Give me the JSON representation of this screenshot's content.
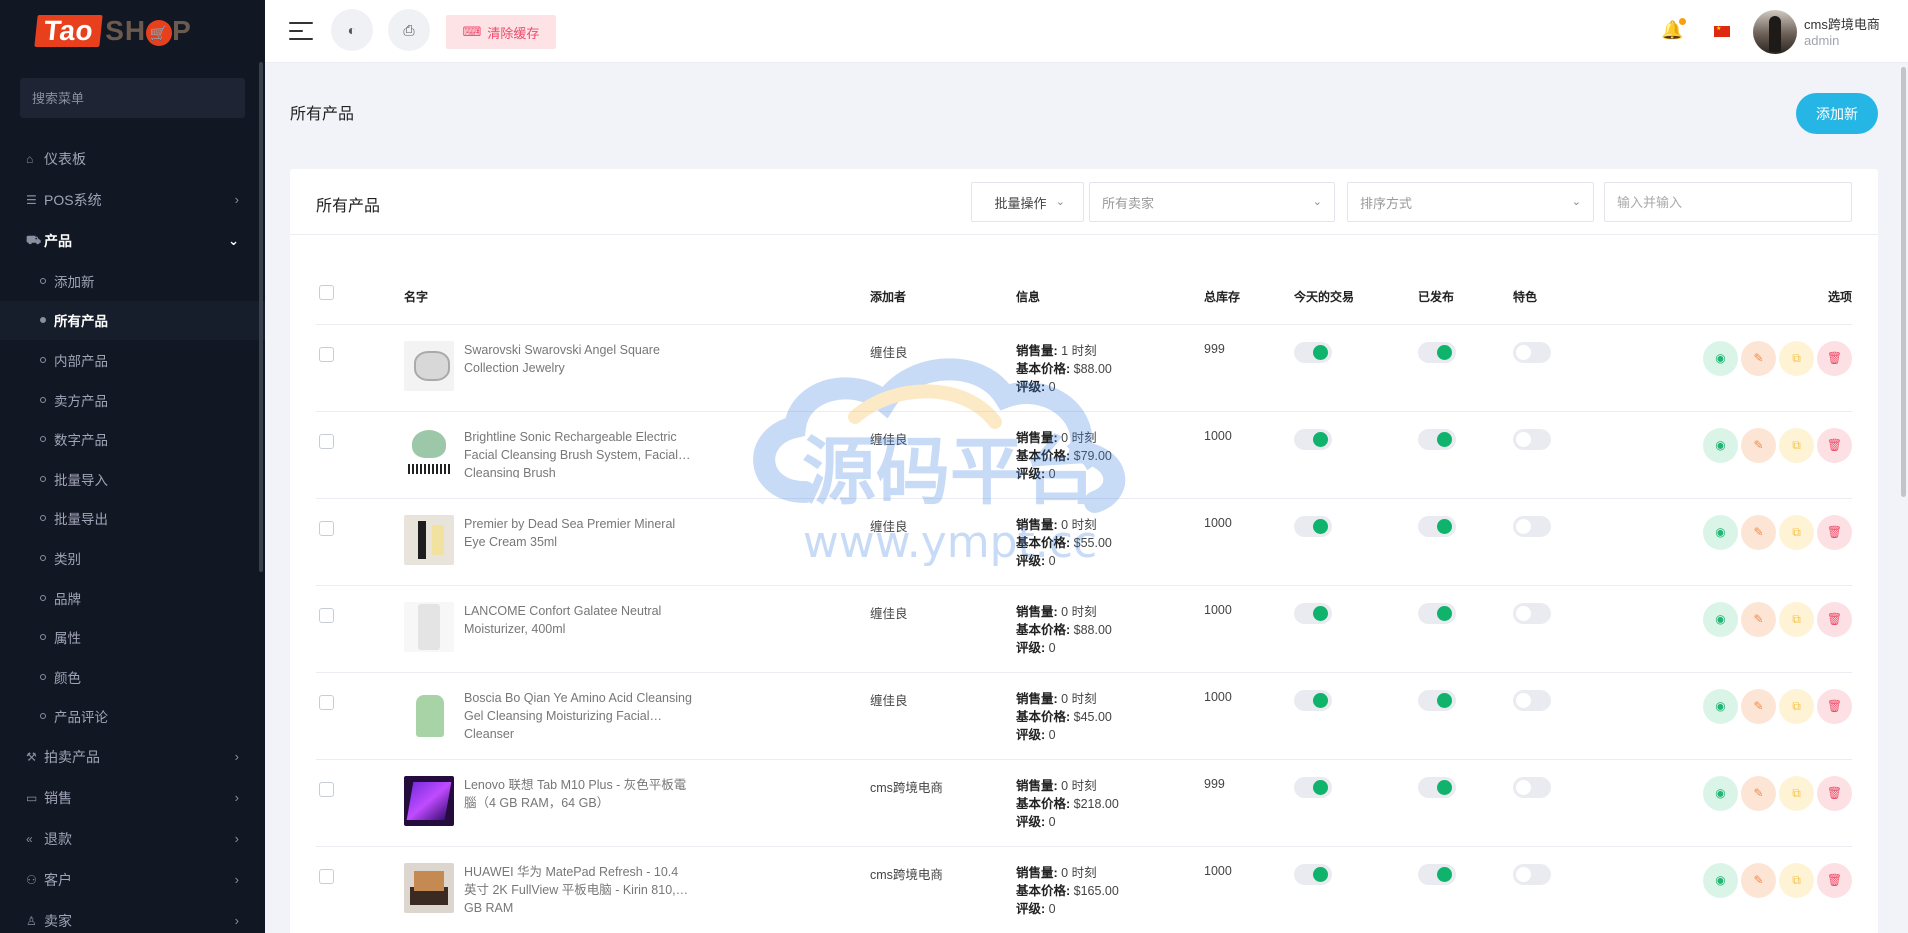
{
  "logo": {
    "part1": "Tao",
    "part2": "SH",
    "part3": "P"
  },
  "sidebar": {
    "search_placeholder": "搜索菜单",
    "items_top": [
      {
        "label": "仪表板",
        "icon": "home-icon",
        "has_chevron": false
      },
      {
        "label": "POS系统",
        "icon": "list-icon",
        "has_chevron": true
      }
    ],
    "products": {
      "label": "产品",
      "sub": [
        {
          "label": "添加新"
        },
        {
          "label": "所有产品",
          "active": true
        },
        {
          "label": "内部产品"
        },
        {
          "label": "卖方产品"
        },
        {
          "label": "数字产品"
        },
        {
          "label": "批量导入"
        },
        {
          "label": "批量导出"
        },
        {
          "label": "类别"
        },
        {
          "label": "品牌"
        },
        {
          "label": "属性"
        },
        {
          "label": "颜色"
        },
        {
          "label": "产品评论"
        }
      ]
    },
    "items_bottom": [
      {
        "label": "拍卖产品",
        "icon": "hammer-icon"
      },
      {
        "label": "销售",
        "icon": "money-icon"
      },
      {
        "label": "退款",
        "icon": "backward-icon"
      },
      {
        "label": "客户",
        "icon": "users-icon"
      },
      {
        "label": "卖家",
        "icon": "user-icon"
      }
    ]
  },
  "header": {
    "clear_cache": "清除缓存",
    "user_name": "cms跨境电商",
    "user_role": "admin"
  },
  "page": {
    "title": "所有产品",
    "add_new": "添加新"
  },
  "card": {
    "title": "所有产品",
    "bulk_action": "批量操作",
    "seller_placeholder": "所有卖家",
    "sort_placeholder": "排序方式",
    "search_placeholder": "输入并输入"
  },
  "table": {
    "headers": {
      "name": "名字",
      "added_by": "添加者",
      "info": "信息",
      "total_stock": "总库存",
      "todays_deal": "今天的交易",
      "published": "已发布",
      "featured": "特色",
      "options": "选项"
    },
    "labels": {
      "sales": "销售量:",
      "base_price": "基本价格:",
      "rating": "评级:"
    },
    "rows": [
      {
        "name": "Swarovski Swarovski Angel Square Collection Jewelry",
        "added_by": "缠佳良",
        "sales": "1 时刻",
        "price": "$88.00",
        "rating": "0",
        "stock": "999",
        "deal": true,
        "published": true,
        "featured": false
      },
      {
        "name": "Brightline Sonic Rechargeable Electric Facial Cleansing Brush System, Facial Cleansing Brush",
        "added_by": "缠佳良",
        "sales": "0 时刻",
        "price": "$79.00",
        "rating": "0",
        "stock": "1000",
        "deal": true,
        "published": true,
        "featured": false
      },
      {
        "name": "Premier by Dead Sea Premier Mineral Eye Cream 35ml",
        "added_by": "缠佳良",
        "sales": "0 时刻",
        "price": "$55.00",
        "rating": "0",
        "stock": "1000",
        "deal": true,
        "published": true,
        "featured": false
      },
      {
        "name": "LANCOME Confort Galatee Neutral Moisturizer, 400ml",
        "added_by": "缠佳良",
        "sales": "0 时刻",
        "price": "$88.00",
        "rating": "0",
        "stock": "1000",
        "deal": true,
        "published": true,
        "featured": false
      },
      {
        "name": "Boscia Bo Qian Ye Amino Acid Cleansing Gel Cleansing Moisturizing Facial Cleanser",
        "added_by": "缠佳良",
        "sales": "0 时刻",
        "price": "$45.00",
        "rating": "0",
        "stock": "1000",
        "deal": true,
        "published": true,
        "featured": false
      },
      {
        "name": "Lenovo 联想 Tab M10 Plus - 灰色平板電腦（4 GB RAM，64 GB）",
        "added_by": "cms跨境电商",
        "sales": "0 时刻",
        "price": "$218.00",
        "rating": "0",
        "stock": "999",
        "deal": true,
        "published": true,
        "featured": false
      },
      {
        "name": "HUAWEI 华为 MatePad Refresh - 10.4 英寸 2K FullView 平板电脑 - Kirin 810,4 GB RAM",
        "added_by": "cms跨境电商",
        "sales": "0 时刻",
        "price": "$165.00",
        "rating": "0",
        "stock": "1000",
        "deal": true,
        "published": true,
        "featured": false
      }
    ]
  },
  "watermark": {
    "text_cn": "源码平台",
    "text_url": "www.ympt.cc"
  },
  "colors": {
    "accent": "#26b6e6",
    "toggle_on": "#10b36b",
    "sidebar_bg": "#111723",
    "danger": "#ef486a"
  }
}
